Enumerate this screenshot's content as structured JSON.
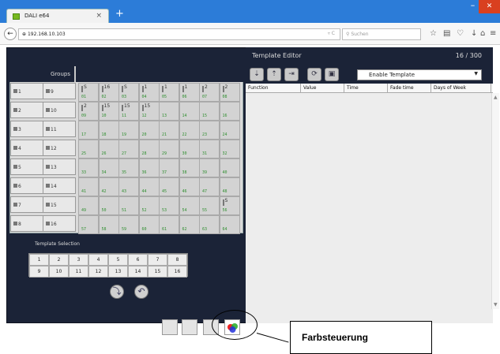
{
  "browser": {
    "tab_title": "DALI e64",
    "new_tab": "+",
    "tab_close": "×",
    "url": "192.168.10.103",
    "search_placeholder": "Suchen"
  },
  "groups": {
    "header": "Groups",
    "left_buttons": [
      "1",
      "2",
      "3",
      "4",
      "5",
      "6",
      "7",
      "8"
    ],
    "right_buttons": [
      "9",
      "10",
      "11",
      "12",
      "13",
      "14",
      "15",
      "16"
    ]
  },
  "grid": {
    "cells": [
      "01",
      "02",
      "03",
      "04",
      "05",
      "06",
      "07",
      "08",
      "09",
      "10",
      "11",
      "12",
      "13",
      "14",
      "15",
      "16",
      "17",
      "18",
      "19",
      "20",
      "21",
      "22",
      "23",
      "24",
      "25",
      "26",
      "27",
      "28",
      "29",
      "30",
      "31",
      "32",
      "33",
      "34",
      "35",
      "36",
      "37",
      "38",
      "39",
      "40",
      "41",
      "42",
      "43",
      "44",
      "45",
      "46",
      "47",
      "48",
      "49",
      "50",
      "51",
      "52",
      "53",
      "54",
      "55",
      "56",
      "57",
      "58",
      "59",
      "60",
      "61",
      "62",
      "63",
      "64"
    ],
    "cell_tags": {
      "01": "S",
      "02": "16",
      "03": "S",
      "04": "1",
      "05": "1",
      "06": "1",
      "07": "2",
      "08": "2",
      "09": "2",
      "10": "15",
      "11": "15",
      "12": "15",
      "56": "S"
    }
  },
  "template_selection": {
    "label": "Template Selection",
    "row1": [
      "1",
      "2",
      "3",
      "4",
      "5",
      "6",
      "7",
      "8"
    ],
    "row2": [
      "9",
      "10",
      "11",
      "12",
      "13",
      "14",
      "15",
      "16"
    ]
  },
  "editor": {
    "title": "Template Editor",
    "count": "16 / 300",
    "select_value": "Enable Template",
    "columns": [
      "Function",
      "Value",
      "Time",
      "Fade time",
      "Days of Week"
    ]
  },
  "callout": {
    "label": "Farbsteuerung"
  },
  "colors": {
    "app_bg": "#1b2337",
    "titlebar": "#2c7cd8",
    "cell_number": "#2f8f2f"
  }
}
